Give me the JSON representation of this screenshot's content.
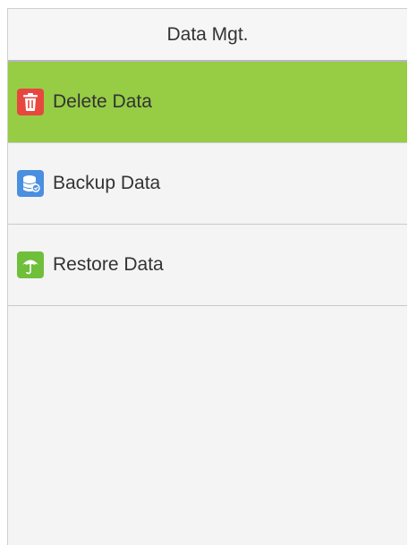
{
  "header": {
    "title": "Data Mgt."
  },
  "menu": {
    "items": [
      {
        "label": "Delete Data",
        "icon": "trash-icon",
        "icon_color": "#e8473f",
        "selected": true
      },
      {
        "label": "Backup Data",
        "icon": "database-icon",
        "icon_color": "#4a8fe0",
        "selected": false
      },
      {
        "label": "Restore Data",
        "icon": "umbrella-icon",
        "icon_color": "#6fbf3b",
        "selected": false
      }
    ]
  },
  "colors": {
    "selected_background": "#96cd45",
    "screen_background": "#f4f4f4",
    "divider": "#c9c9c9",
    "header_divider": "#b9b3c4"
  }
}
